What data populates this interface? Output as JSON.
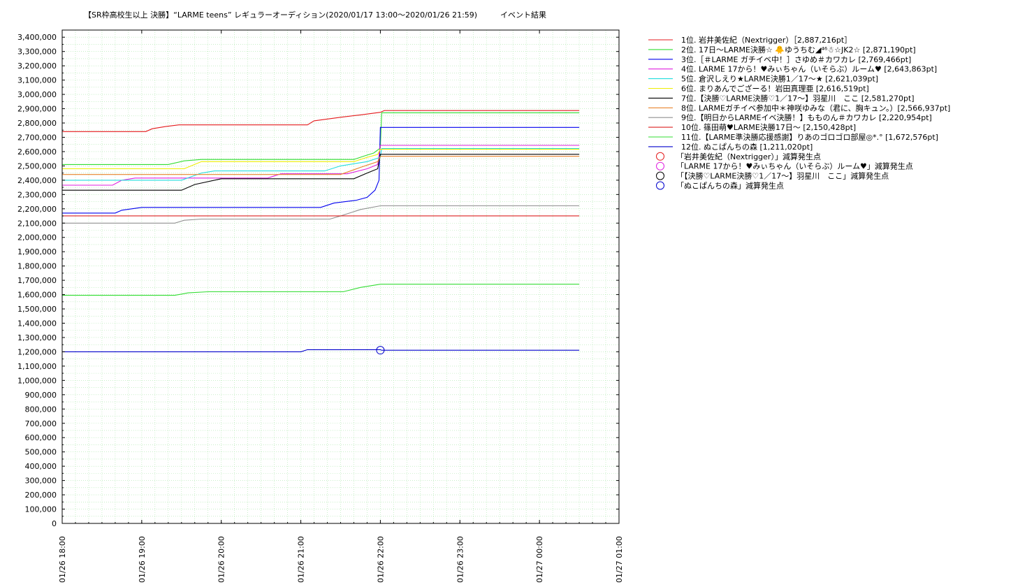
{
  "chart_data": {
    "type": "line",
    "title": "【SR枠高校生以上 決勝】“LARME teens” レギュラーオーディション(2020/01/17 13:00〜2020/01/26 21:59)　　　イベント結果",
    "xlabel": "",
    "ylabel": "",
    "ylim": [
      0,
      3450000
    ],
    "y_ticks": [
      0,
      100000,
      200000,
      300000,
      400000,
      500000,
      600000,
      700000,
      800000,
      900000,
      1000000,
      1100000,
      1200000,
      1300000,
      1400000,
      1500000,
      1600000,
      1700000,
      1800000,
      1900000,
      2000000,
      2100000,
      2200000,
      2300000,
      2400000,
      2500000,
      2600000,
      2700000,
      2800000,
      2900000,
      3000000,
      3100000,
      3200000,
      3300000,
      3400000
    ],
    "y_tick_labels": [
      "0",
      "100,000",
      "200,000",
      "300,000",
      "400,000",
      "500,000",
      "600,000",
      "700,000",
      "800,000",
      "900,000",
      "1,000,000",
      "1,100,000",
      "1,200,000",
      "1,300,000",
      "1,400,000",
      "1,500,000",
      "1,600,000",
      "1,700,000",
      "1,800,000",
      "1,900,000",
      "2,000,000",
      "2,100,000",
      "2,200,000",
      "2,300,000",
      "2,400,000",
      "2,500,000",
      "2,600,000",
      "2,700,000",
      "2,800,000",
      "2,900,000",
      "3,000,000",
      "3,100,000",
      "3,200,000",
      "3,300,000",
      "3,400,000"
    ],
    "x_unit": "minutes from 01/26 18:00",
    "xlim": [
      0,
      420
    ],
    "x_ticks": [
      0,
      60,
      120,
      180,
      240,
      300,
      360,
      420
    ],
    "x_tick_labels": [
      "01/26 18:00",
      "01/26 19:00",
      "01/26 20:00",
      "01/26 21:00",
      "01/26 22:00",
      "01/26 23:00",
      "01/27 00:00",
      "01/27 01:00"
    ],
    "grid": true,
    "legend_position": "right",
    "series": [
      {
        "name": "1位. 岩井美佐紀（Nextrigger）［2,887,216pt］",
        "color": "#e41a1c",
        "points": [
          [
            0,
            2740000
          ],
          [
            63,
            2740000
          ],
          [
            68,
            2760000
          ],
          [
            78,
            2775000
          ],
          [
            88,
            2787000
          ],
          [
            185,
            2787000
          ],
          [
            190,
            2815000
          ],
          [
            210,
            2840000
          ],
          [
            225,
            2857000
          ],
          [
            240,
            2875000
          ],
          [
            243,
            2887216
          ],
          [
            390,
            2887216
          ]
        ]
      },
      {
        "name": "2位. 17日〜LARME決勝☆ 🐥ゆうちむ◢⁴⁶☃☆JK2☆ [2,871,190pt]",
        "color": "#33dd33",
        "points": [
          [
            0,
            2510000
          ],
          [
            80,
            2510000
          ],
          [
            92,
            2535000
          ],
          [
            105,
            2545000
          ],
          [
            220,
            2545000
          ],
          [
            228,
            2570000
          ],
          [
            235,
            2590000
          ],
          [
            240,
            2625000
          ],
          [
            241,
            2871190
          ],
          [
            390,
            2871190
          ]
        ]
      },
      {
        "name": "3位.［＃LARME ガチイベ中！］さゆめ＃カワカレ [2,769,466pt]",
        "color": "#0000ee",
        "points": [
          [
            0,
            2170000
          ],
          [
            40,
            2170000
          ],
          [
            45,
            2190000
          ],
          [
            60,
            2210000
          ],
          [
            195,
            2210000
          ],
          [
            205,
            2240000
          ],
          [
            222,
            2260000
          ],
          [
            230,
            2280000
          ],
          [
            236,
            2330000
          ],
          [
            239,
            2400000
          ],
          [
            240,
            2769466
          ],
          [
            390,
            2769466
          ]
        ]
      },
      {
        "name": "4位. LARME 17から！♥みぃちゃん（いそらぶ）ルーム♥ [2,643,863pt]",
        "color": "#e020e0",
        "points": [
          [
            0,
            2365000
          ],
          [
            38,
            2365000
          ],
          [
            45,
            2400000
          ],
          [
            55,
            2415000
          ],
          [
            155,
            2415000
          ],
          [
            165,
            2445000
          ],
          [
            215,
            2445000
          ],
          [
            230,
            2480000
          ],
          [
            238,
            2510000
          ],
          [
            240,
            2643863
          ],
          [
            390,
            2643863
          ]
        ]
      },
      {
        "name": "5位. 倉沢しえり★LARME決勝1／17〜★ [2,621,039pt]",
        "color": "#22dddd",
        "points": [
          [
            0,
            2400000
          ],
          [
            90,
            2400000
          ],
          [
            105,
            2450000
          ],
          [
            115,
            2465000
          ],
          [
            198,
            2465000
          ],
          [
            210,
            2500000
          ],
          [
            230,
            2530000
          ],
          [
            240,
            2560000
          ],
          [
            241,
            2621039
          ],
          [
            390,
            2621039
          ]
        ]
      },
      {
        "name": "6位. まりあんでござーる！岩田真理亜 [2,616,519pt]",
        "color": "#eeee00",
        "points": [
          [
            0,
            2480000
          ],
          [
            92,
            2480000
          ],
          [
            105,
            2530000
          ],
          [
            220,
            2530000
          ],
          [
            230,
            2560000
          ],
          [
            238,
            2580000
          ],
          [
            240,
            2616519
          ],
          [
            390,
            2616519
          ]
        ]
      },
      {
        "name": "7位.【決勝♡LARME決勝♡1／17〜】羽星川　ここ [2,581,270pt]",
        "color": "#000000",
        "points": [
          [
            0,
            2330000
          ],
          [
            90,
            2330000
          ],
          [
            100,
            2370000
          ],
          [
            120,
            2410000
          ],
          [
            220,
            2410000
          ],
          [
            230,
            2450000
          ],
          [
            238,
            2480000
          ],
          [
            240,
            2581270
          ],
          [
            390,
            2581270
          ]
        ]
      },
      {
        "name": "8位. LARMEガチイベ参加中＊神咲ゆみな（君に、胸キュン。）[2,566,937pt]",
        "color": "#e8822a",
        "points": [
          [
            0,
            2440000
          ],
          [
            210,
            2440000
          ],
          [
            225,
            2490000
          ],
          [
            238,
            2530000
          ],
          [
            240,
            2566937
          ],
          [
            390,
            2566937
          ]
        ]
      },
      {
        "name": "9位.【明日からLARMEイベ決勝！】もものん＃カワカレ [2,220,954pt]",
        "color": "#909090",
        "points": [
          [
            0,
            2100000
          ],
          [
            85,
            2100000
          ],
          [
            92,
            2120000
          ],
          [
            105,
            2128000
          ],
          [
            202,
            2128000
          ],
          [
            210,
            2150000
          ],
          [
            225,
            2195000
          ],
          [
            240,
            2220954
          ],
          [
            390,
            2220954
          ]
        ]
      },
      {
        "name": "10位. 篠田萌♥LARME決勝17日〜 [2,150,428pt]",
        "color": "#dd2020",
        "points": [
          [
            0,
            2150428
          ],
          [
            390,
            2150428
          ]
        ]
      },
      {
        "name": "11位.【LARME準決勝応援感謝】りあのゴロゴロ部屋◎*.° [1,672,576pt]",
        "color": "#33dd33",
        "points": [
          [
            0,
            1595000
          ],
          [
            85,
            1595000
          ],
          [
            95,
            1612000
          ],
          [
            110,
            1620000
          ],
          [
            212,
            1620000
          ],
          [
            225,
            1650000
          ],
          [
            240,
            1672576
          ],
          [
            390,
            1672576
          ]
        ]
      },
      {
        "name": "12位. ぬこぱんちの森 [1,211,020pt]",
        "color": "#0000cc",
        "points": [
          [
            0,
            1200000
          ],
          [
            180,
            1200000
          ],
          [
            185,
            1215000
          ],
          [
            240,
            1215000
          ],
          [
            241,
            1211020
          ],
          [
            390,
            1211020
          ]
        ]
      }
    ],
    "markers": [
      {
        "name": "「岩井美佐紀（Nextrigger）」減算発生点",
        "color": "#e41a1c",
        "points": []
      },
      {
        "name": "「LARME 17から！♥みぃちゃん（いそらぶ）ルーム♥」減算発生点",
        "color": "#e020e0",
        "points": []
      },
      {
        "name": "「【決勝♡LARME決勝♡1／17〜】羽星川　ここ」減算発生点",
        "color": "#000000",
        "points": []
      },
      {
        "name": "「ぬこぱんちの森」減算発生点",
        "color": "#0000cc",
        "points": [
          [
            240,
            1211020
          ]
        ]
      }
    ]
  }
}
